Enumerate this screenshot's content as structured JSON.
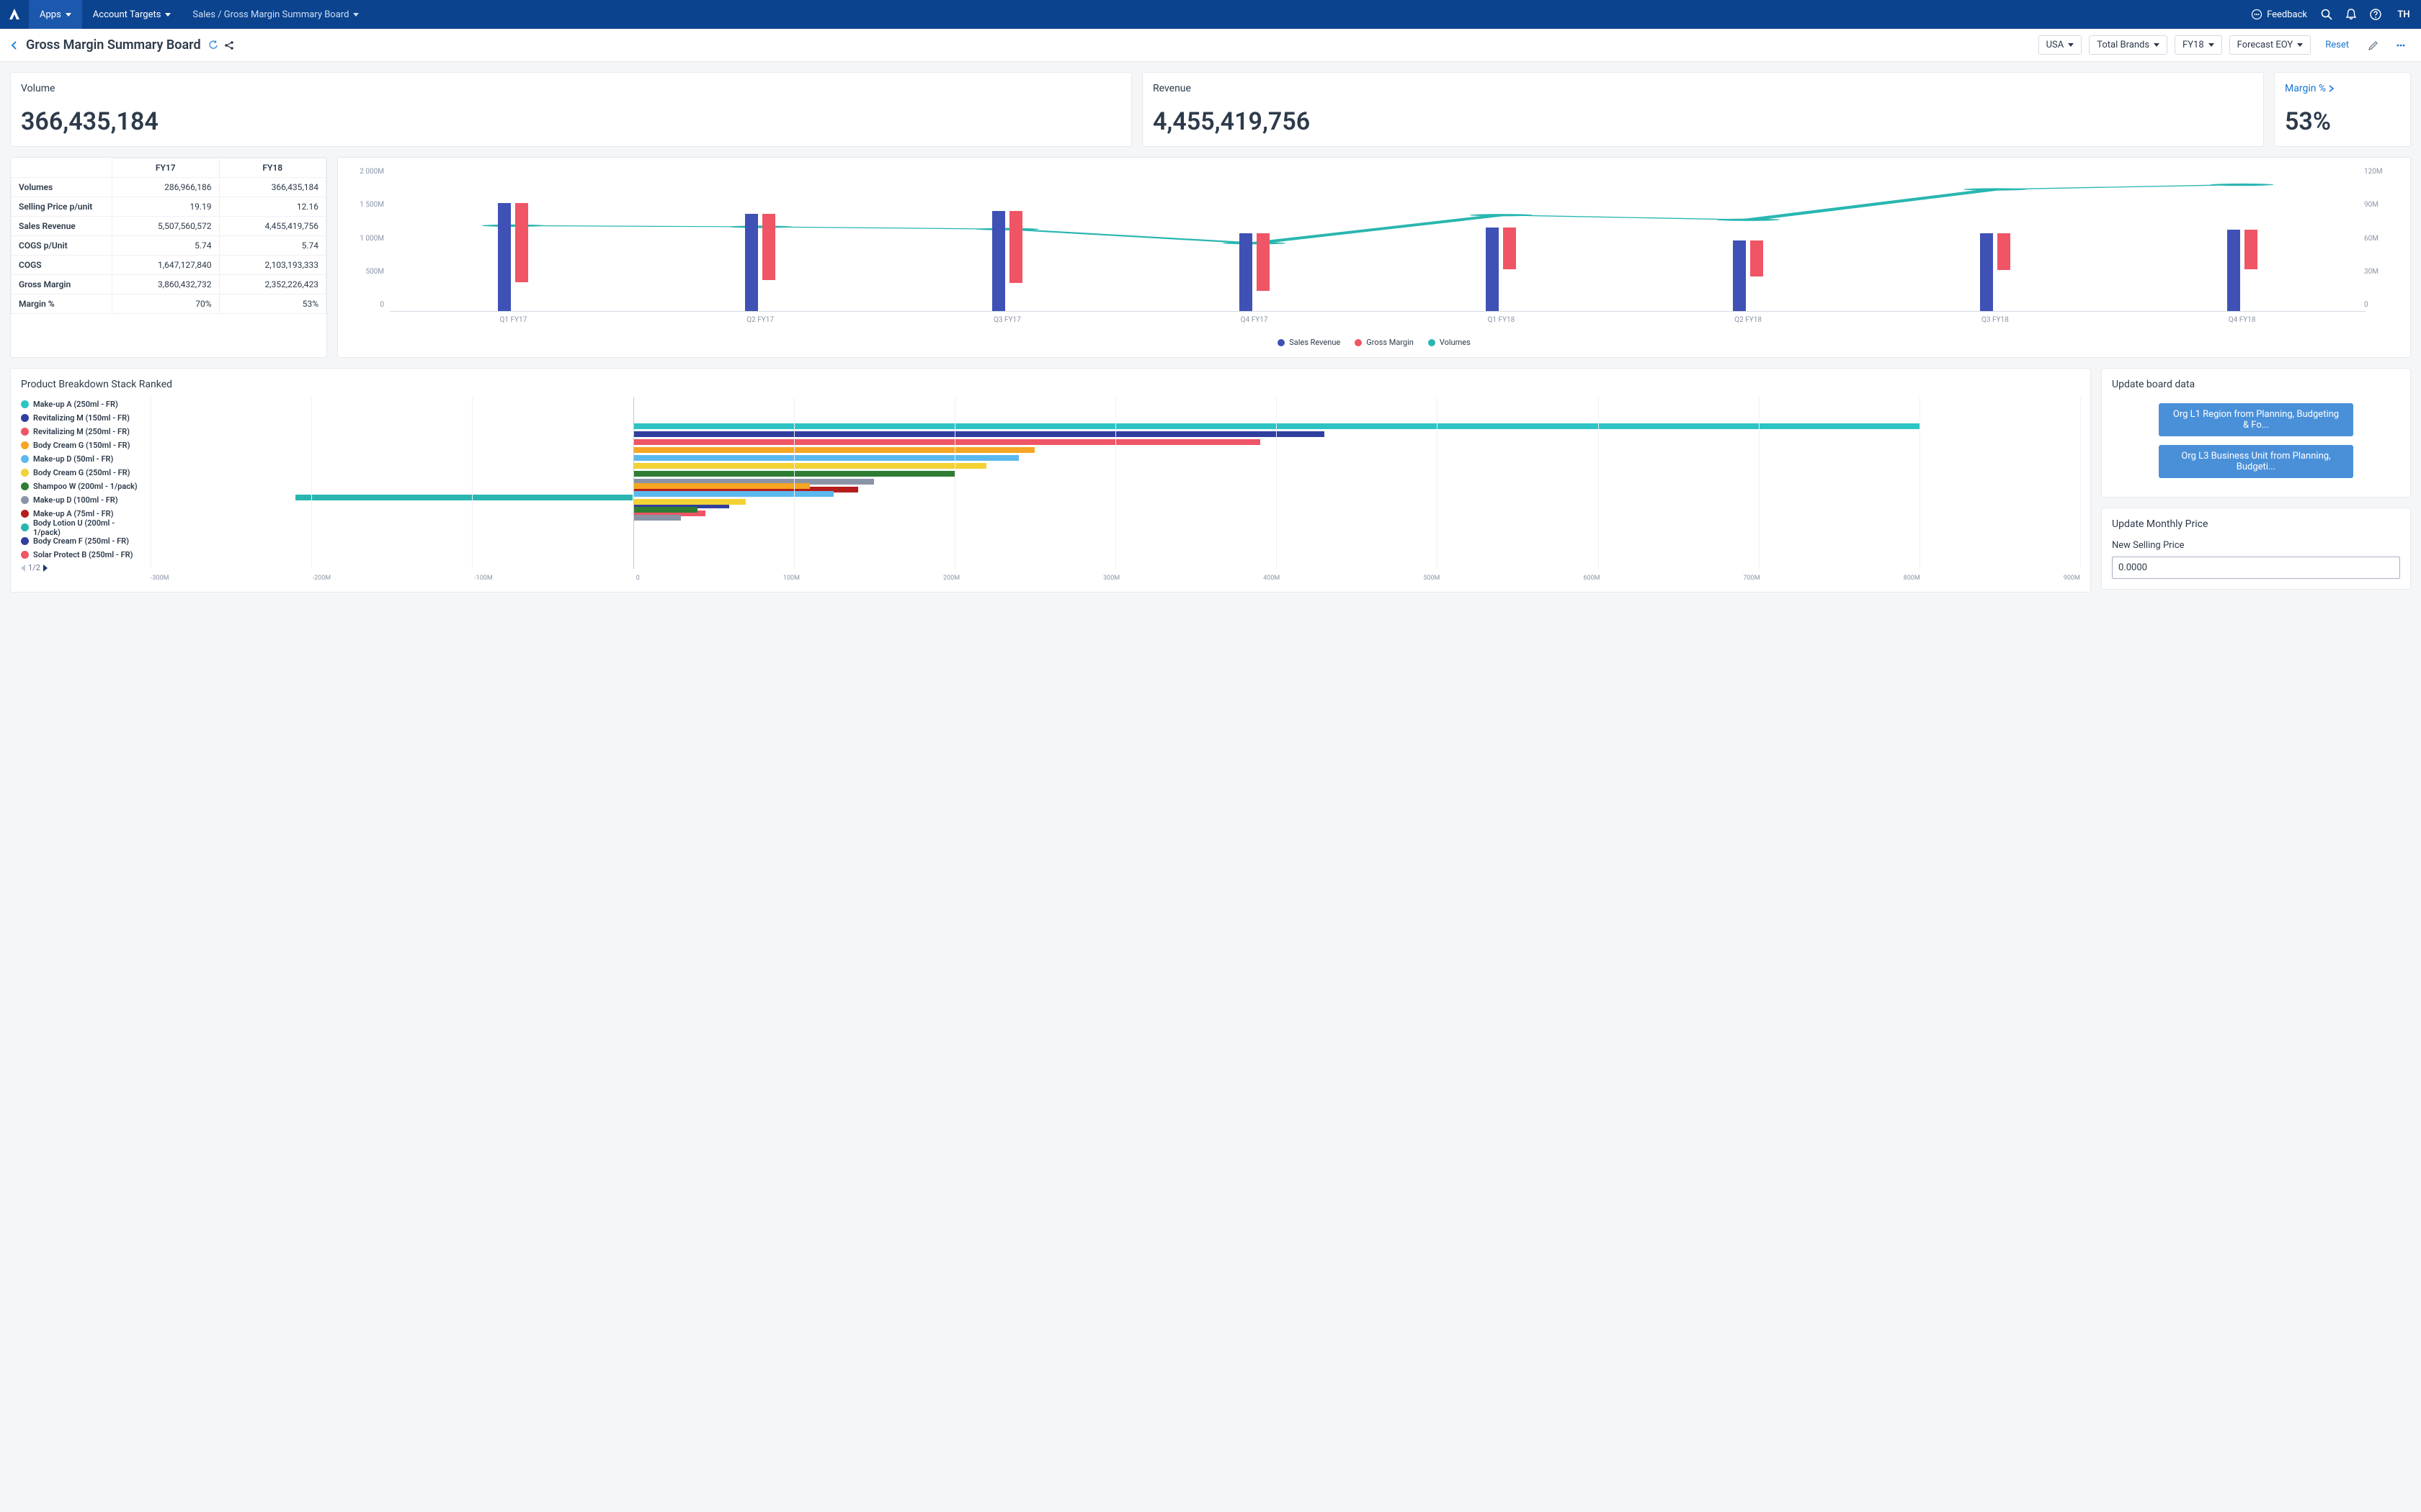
{
  "topbar": {
    "apps_label": "Apps",
    "breadcrumb1": "Account Targets",
    "breadcrumb2": "Sales / Gross Margin Summary Board",
    "feedback_label": "Feedback",
    "avatar_initials": "TH"
  },
  "subbar": {
    "title": "Gross Margin Summary Board",
    "filter_region": "USA",
    "filter_brands": "Total Brands",
    "filter_year": "FY18",
    "filter_scenario": "Forecast EOY",
    "reset_label": "Reset"
  },
  "kpi": {
    "volume_label": "Volume",
    "volume_value": "366,435,184",
    "revenue_label": "Revenue",
    "revenue_value": "4,455,419,756",
    "margin_label": "Margin %",
    "margin_value": "53%"
  },
  "table": {
    "col1": "FY17",
    "col2": "FY18",
    "rows": [
      {
        "label": "Volumes",
        "v1": "286,966,186",
        "v2": "366,435,184"
      },
      {
        "label": "Selling Price p/unit",
        "v1": "19.19",
        "v2": "12.16"
      },
      {
        "label": "Sales Revenue",
        "v1": "5,507,560,572",
        "v2": "4,455,419,756"
      },
      {
        "label": "COGS p/Unit",
        "v1": "5.74",
        "v2": "5.74"
      },
      {
        "label": "COGS",
        "v1": "1,647,127,840",
        "v2": "2,103,193,333"
      },
      {
        "label": "Gross Margin",
        "v1": "3,860,432,732",
        "v2": "2,352,226,423"
      },
      {
        "label": "Margin %",
        "v1": "70%",
        "v2": "53%"
      }
    ]
  },
  "chart": {
    "y_ticks": [
      "2 000M",
      "1 500M",
      "1 000M",
      "500M",
      "0"
    ],
    "y2_ticks": [
      "120M",
      "90M",
      "60M",
      "30M",
      "0"
    ],
    "categories": [
      "Q1 FY17",
      "Q2 FY17",
      "Q3 FY17",
      "Q4 FY17",
      "Q1 FY18",
      "Q2 FY18",
      "Q3 FY18",
      "Q4 FY18"
    ],
    "legend": {
      "rev": "Sales Revenue",
      "gm": "Gross Margin",
      "vol": "Volumes"
    }
  },
  "chart_data": {
    "type": "bar",
    "title": "",
    "categories": [
      "Q1 FY17",
      "Q2 FY17",
      "Q3 FY17",
      "Q4 FY17",
      "Q1 FY18",
      "Q2 FY18",
      "Q3 FY18",
      "Q4 FY18"
    ],
    "series": [
      {
        "name": "Sales Revenue",
        "unit": "M",
        "values": [
          1530,
          1380,
          1420,
          1100,
          1180,
          1000,
          1100,
          1150
        ],
        "axis": "left",
        "color": "#3f51b5",
        "kind": "bar"
      },
      {
        "name": "Gross Margin",
        "unit": "M",
        "values": [
          1120,
          940,
          1020,
          810,
          590,
          510,
          520,
          560
        ],
        "axis": "left",
        "color": "#ef5565",
        "kind": "bar"
      },
      {
        "name": "Volumes",
        "unit": "M",
        "values": [
          73,
          72,
          70,
          58,
          82,
          78,
          104,
          108
        ],
        "axis": "right",
        "color": "#29b6b0",
        "kind": "line"
      }
    ],
    "y_left": {
      "min": 0,
      "max": 2000,
      "label": ""
    },
    "y_right": {
      "min": 0,
      "max": 120,
      "label": ""
    }
  },
  "pbr": {
    "title": "Product Breakdown Stack Ranked",
    "pager": "1/2",
    "x_ticks": [
      "-300M",
      "-200M",
      "-100M",
      "0",
      "100M",
      "200M",
      "300M",
      "400M",
      "500M",
      "600M",
      "700M",
      "800M",
      "900M"
    ],
    "items": [
      {
        "label": "Make-up A (250ml - FR)",
        "color": "#2ec4c4",
        "value": 800
      },
      {
        "label": "Revitalizing M (150ml - FR)",
        "color": "#303f9f",
        "value": 430
      },
      {
        "label": "Revitalizing M (250ml - FR)",
        "color": "#ef5565",
        "value": 390
      },
      {
        "label": "Body Cream G (150ml - FR)",
        "color": "#f6a623",
        "value": 250
      },
      {
        "label": "Make-up D (50ml - FR)",
        "color": "#5bb9ee",
        "value": 240
      },
      {
        "label": "Body Cream G (250ml - FR)",
        "color": "#f3d234",
        "value": 220
      },
      {
        "label": "Shampoo W (200ml - 1/pack)",
        "color": "#2e7d32",
        "value": 200
      },
      {
        "label": "Make-up D (100ml - FR)",
        "color": "#8a94a6",
        "value": 150
      },
      {
        "label": "Make-up A (75ml - FR)",
        "color": "#b71c1c",
        "value": 140
      },
      {
        "label": "Body Lotion U (200ml - 1/pack)",
        "color": "#29b6b0",
        "value": -210
      },
      {
        "label": "Body Cream F (250ml - FR)",
        "color": "#303f9f",
        "value": 60
      },
      {
        "label": "Solar Protect B (250ml - FR)",
        "color": "#ef5565",
        "value": 45
      }
    ],
    "extra_bars": [
      {
        "color": "#f6a623",
        "value": 110,
        "row": 7.5
      },
      {
        "color": "#5bb9ee",
        "value": 125,
        "row": 8.5
      },
      {
        "color": "#f3d234",
        "value": 70,
        "row": 9.5
      },
      {
        "color": "#2e7d32",
        "value": 40,
        "row": 10.5
      },
      {
        "color": "#8a94a6",
        "value": 30,
        "row": 11.5
      }
    ]
  },
  "update": {
    "title": "Update board data",
    "btn1": "Org L1 Region from Planning, Budgeting & Fo...",
    "btn2": "Org L3 Business Unit from Planning, Budgeti..."
  },
  "price": {
    "title": "Update Monthly Price",
    "label": "New Selling Price",
    "value": "0.0000"
  }
}
